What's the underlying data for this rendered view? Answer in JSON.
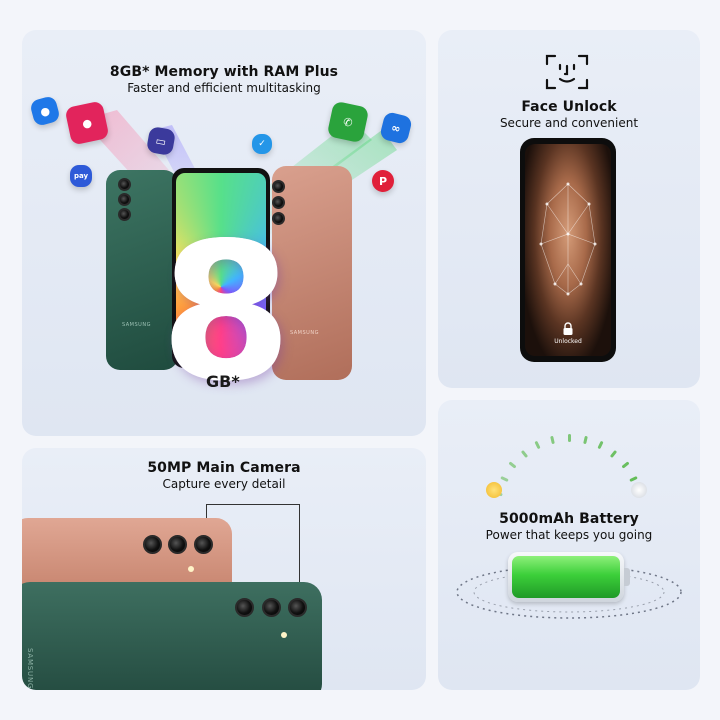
{
  "memory": {
    "title": "8GB* Memory with RAM Plus",
    "subtitle": "Faster and efficient multitasking",
    "big_digit": "8",
    "gb_label": "GB*",
    "brand_left": "SAMSUNG",
    "brand_right": "SAMSUNG"
  },
  "face": {
    "title": "Face Unlock",
    "subtitle": "Secure and convenient",
    "unlocked_label": "Unlocked"
  },
  "camera": {
    "title": "50MP Main Camera",
    "subtitle": "Capture every detail",
    "brand": "SAMSUNG"
  },
  "battery": {
    "title": "5000mAh Battery",
    "subtitle": "Power that keeps you going",
    "charge_fraction": 1.0
  },
  "colors": {
    "accent_green": "#3ccf3a",
    "phone_green": "#2f5d4e",
    "phone_copper": "#c98772"
  },
  "icons": [
    "face-scan-icon",
    "lock-icon",
    "app-icon-pink",
    "app-icon-green",
    "app-icon-blue",
    "app-icon-twitter",
    "app-icon-pinterest",
    "app-icon-pay"
  ]
}
